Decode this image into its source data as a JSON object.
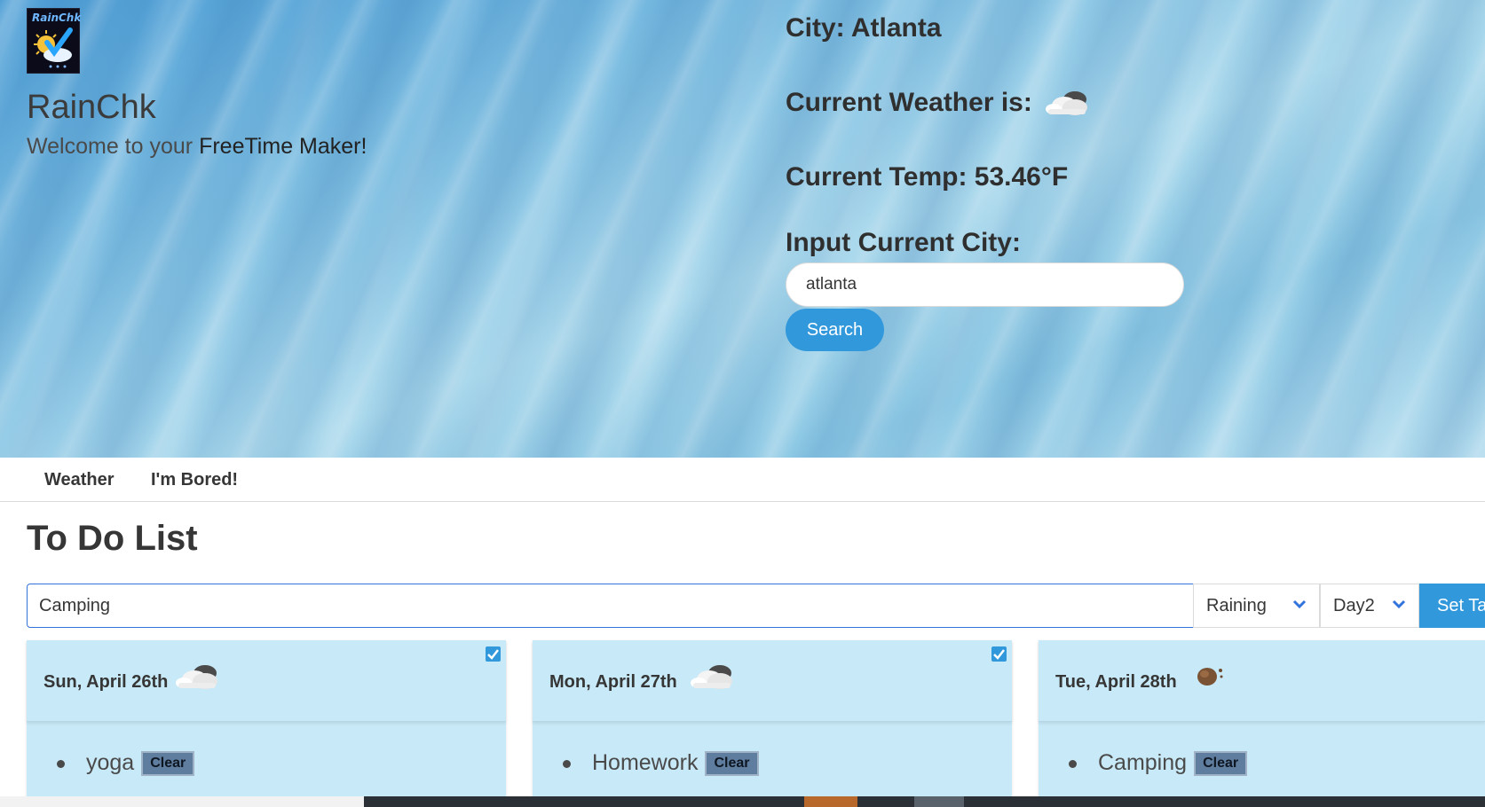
{
  "brand": {
    "logo_text": "RainChk",
    "title": "RainChk",
    "subtitle_prefix": "Welcome to your ",
    "subtitle_strong": "FreeTime Maker!"
  },
  "weather": {
    "city_label": "City: Atlanta",
    "current_weather_label": "Current Weather is:",
    "current_weather_icon": "cloud-icon",
    "temp_label": "Current Temp: 53.46°F",
    "input_label": "Input Current City:",
    "city_input_value": "atlanta",
    "search_button": "Search"
  },
  "tabs": [
    {
      "label": "Weather"
    },
    {
      "label": "I'm Bored!"
    }
  ],
  "todo": {
    "title": "To Do List",
    "task_input_value": "Camping",
    "weather_select": "Raining",
    "day_select": "Day2",
    "set_task_button": "Set Ta"
  },
  "cards": [
    {
      "date": "Sun, April 26th",
      "icon": "cloud-icon",
      "checked": true,
      "task": "yoga",
      "clear": "Clear"
    },
    {
      "date": "Mon, April 27th",
      "icon": "cloud-icon",
      "checked": true,
      "task": "Homework",
      "clear": "Clear"
    },
    {
      "date": "Tue, April 28th",
      "icon": "meteor-icon",
      "checked": false,
      "task": "Camping",
      "clear": "Clear"
    }
  ],
  "colors": {
    "accent": "#3298dc",
    "card_background": "#c8e9f7",
    "input_focus_border": "#3273dc"
  }
}
